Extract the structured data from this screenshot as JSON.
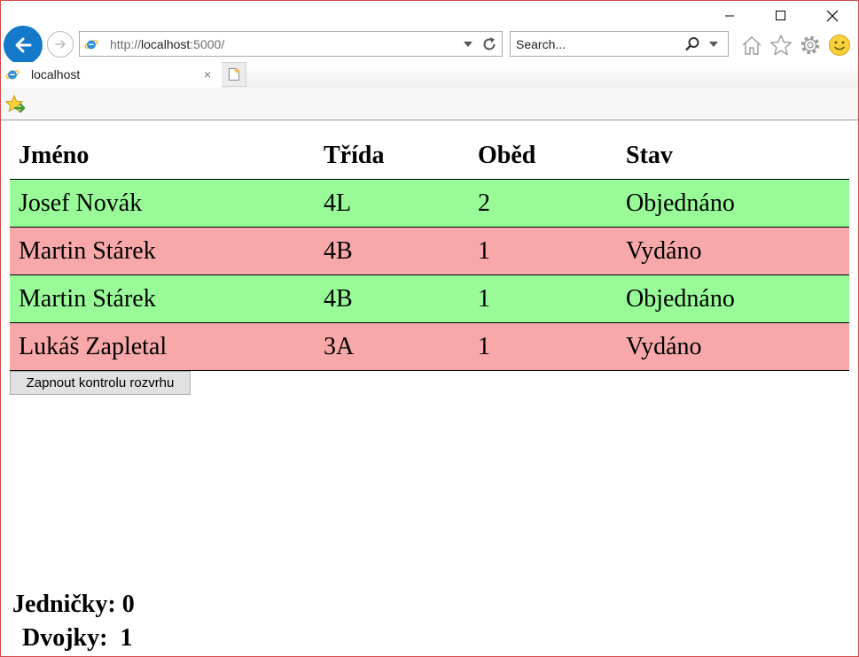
{
  "browser": {
    "address_url_prefix": "http://",
    "address_url_host": "localhost",
    "address_url_suffix": ":5000/",
    "search_placeholder": "Search...",
    "tab_title": "localhost",
    "tab_close": "×"
  },
  "table": {
    "headers": [
      "Jméno",
      "Třída",
      "Oběd",
      "Stav"
    ],
    "rows": [
      {
        "name": "Josef Novák",
        "class": "4L",
        "lunch": "2",
        "status": "Objednáno",
        "color": "#98fb98"
      },
      {
        "name": "Martin Stárek",
        "class": "4B",
        "lunch": "1",
        "status": "Vydáno",
        "color": "#f8a8a8"
      },
      {
        "name": "Martin Stárek",
        "class": "4B",
        "lunch": "1",
        "status": "Objednáno",
        "color": "#98fb98"
      },
      {
        "name": "Lukáš Zapletal",
        "class": "3A",
        "lunch": "1",
        "status": "Vydáno",
        "color": "#f8a8a8"
      }
    ]
  },
  "controls": {
    "toggle_label": "Zapnout kontrolu rozvrhu"
  },
  "stats": {
    "ones_label": "Jedničky:",
    "ones_value": "0",
    "twos_label": "Dvojky:",
    "twos_value": "1"
  },
  "colors": {
    "ordered_row": "#98fb98",
    "served_row": "#f8a8a8",
    "back_button": "#1479c9"
  },
  "icons": [
    "minimize-icon",
    "maximize-icon",
    "close-icon",
    "back-arrow-icon",
    "forward-arrow-icon",
    "ie-page-icon",
    "dropdown-arrow-icon",
    "refresh-icon",
    "search-icon",
    "home-icon",
    "favorites-star-icon",
    "settings-gear-icon",
    "smiley-feedback-icon",
    "new-tab-icon",
    "add-to-favorites-bar-icon"
  ]
}
